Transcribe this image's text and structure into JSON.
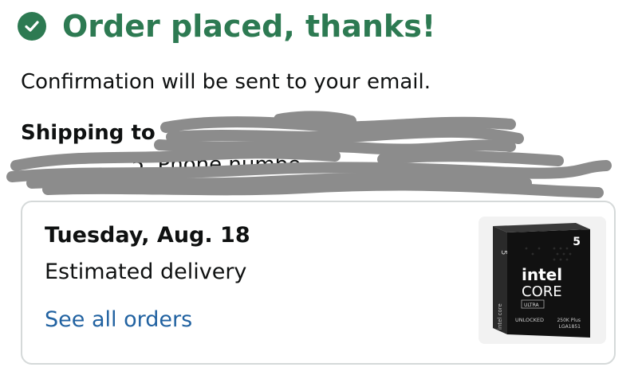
{
  "header": {
    "title": "Order placed, thanks!",
    "confirmation_text": "Confirmation will be sent to your email.",
    "check_icon": "check-circle-icon",
    "accent_color": "#2d7a52"
  },
  "shipping": {
    "label": "Shipping to",
    "phone_fragment": "5, Phone numbe"
  },
  "delivery_card": {
    "date": "Tuesday, Aug. 18",
    "estimate_label": "Estimated delivery",
    "link_label": "See all orders",
    "link_color": "#2162a1",
    "product": {
      "brand": "intel",
      "line": "CORE",
      "tier": "ULTRA",
      "number": "5",
      "unlocked": "UNLOCKED",
      "model": "250K Plus",
      "socket": "LGA1851",
      "side_text": "intel core"
    }
  }
}
